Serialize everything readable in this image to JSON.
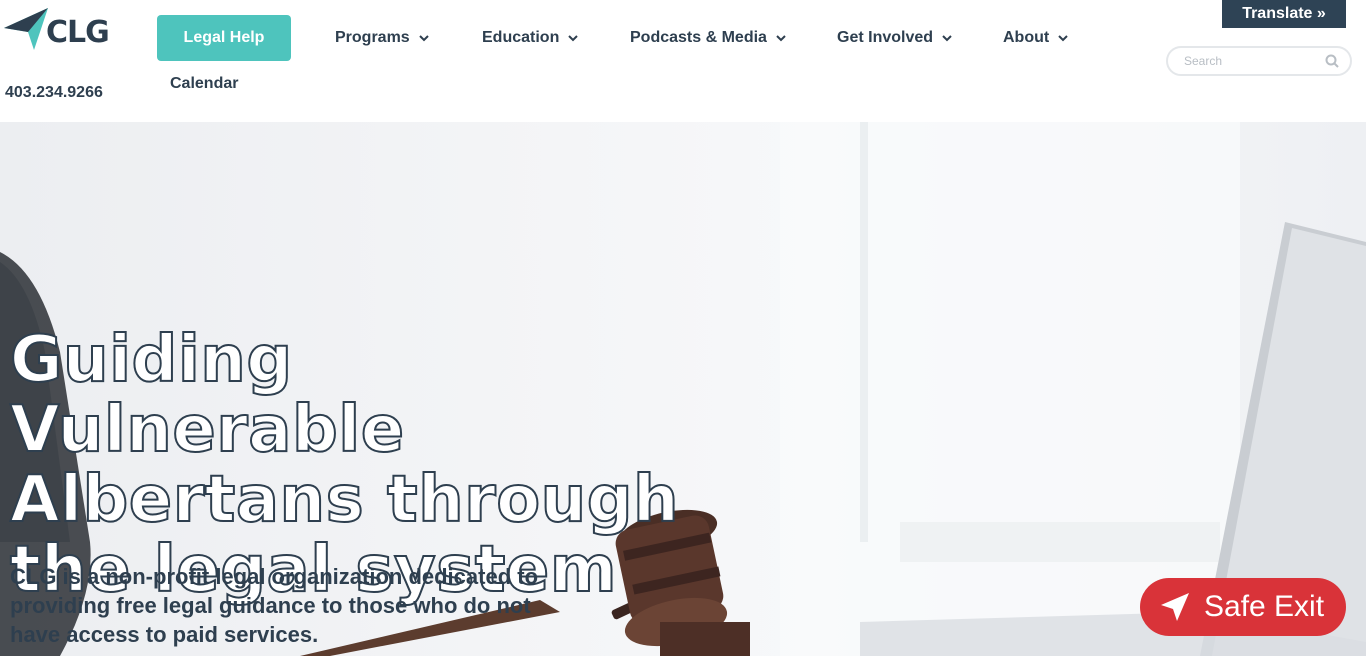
{
  "header": {
    "logo_text": "CLG",
    "phone": "403.234.9266",
    "legal_help_label": "Legal Help",
    "calendar_label": "Calendar",
    "nav": [
      {
        "label": "Programs",
        "icon": "chevron-down-icon"
      },
      {
        "label": "Education",
        "icon": "chevron-down-icon"
      },
      {
        "label": "Podcasts & Media",
        "icon": "chevron-down-icon"
      },
      {
        "label": "Get Involved",
        "icon": "chevron-down-icon"
      },
      {
        "label": "About",
        "icon": "chevron-down-icon"
      }
    ],
    "translate_label": "Translate »",
    "search": {
      "placeholder": "Search",
      "value": "",
      "icon": "search-icon"
    }
  },
  "hero": {
    "title_line1": "Guiding Vulnerable",
    "title_line2": "Albertans through",
    "title_line3": "the legal system",
    "subtitle": "CLG is a non-profit legal organization dedicated to providing free legal guidance to those who do not have access to paid services."
  },
  "safe_exit": {
    "label": "Safe Exit",
    "icon": "paper-plane-icon"
  },
  "colors": {
    "brand_dark": "#2e3f4f",
    "brand_teal": "#4ec4bd",
    "translate_bg": "#2e4355",
    "safe_exit_bg": "#d93339"
  }
}
